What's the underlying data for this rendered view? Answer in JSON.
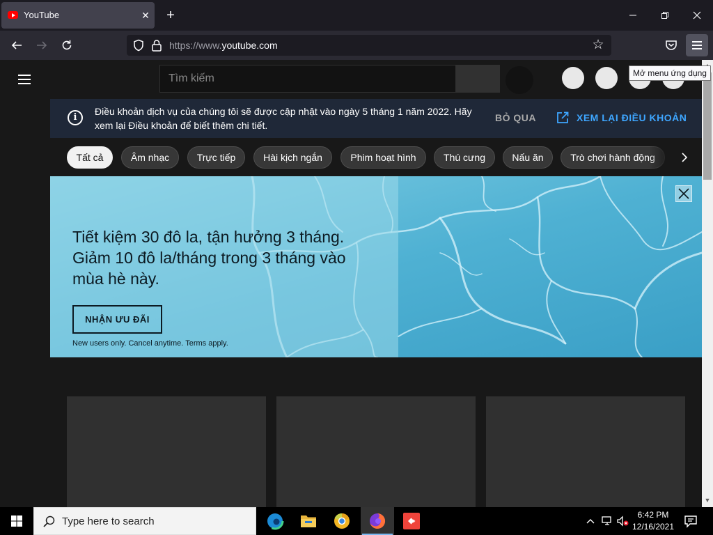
{
  "browser": {
    "tab_title": "YouTube",
    "new_tab_label": "+",
    "url_prefix": "https://www.",
    "url_host": "youtube.com",
    "menu_tooltip": "Mở menu ứng dụng",
    "icons": [
      "youtube-favicon",
      "close-icon",
      "plus-icon",
      "minimize-icon",
      "restore-icon",
      "window-close-icon",
      "back-icon",
      "forward-icon",
      "reload-icon",
      "shield-icon",
      "lock-icon",
      "star-icon",
      "pocket-icon",
      "hamburger-icon"
    ]
  },
  "youtube": {
    "search_placeholder": "Tìm kiếm",
    "notice": {
      "text": "Điều khoản dịch vụ của chúng tôi sẽ được cập nhật vào ngày 5 tháng 1 năm 2022. Hãy xem lại Điều khoản để biết thêm chi tiết.",
      "skip_label": "BỎ QUA",
      "review_label": "XEM LẠI ĐIỀU KHOẢN"
    },
    "chips": [
      "Tất cả",
      "Âm nhạc",
      "Trực tiếp",
      "Hài kịch ngắn",
      "Phim hoạt hình",
      "Thú cưng",
      "Nấu ăn",
      "Trò chơi hành động"
    ],
    "active_chip": "Tất cả",
    "banner": {
      "headline": "Tiết kiệm 30 đô la, tận hưởng 3 tháng. Giảm 10 đô la/tháng trong 3 tháng vào mùa hè này.",
      "cta_label": "NHẬN ƯU ĐÃI",
      "fine_print": "New users only. Cancel anytime. Terms apply."
    }
  },
  "taskbar": {
    "search_placeholder": "Type here to search",
    "time": "6:42 PM",
    "date": "12/16/2021",
    "apps": [
      "edge-icon",
      "file-explorer-icon",
      "chrome-canary-icon",
      "firefox-icon",
      "anydesk-icon"
    ]
  },
  "colors": {
    "tab_bg": "#42414d",
    "nav_bg": "#2b2a33",
    "page_bg": "#181818",
    "notice_bg": "#1f2838",
    "link_blue": "#3ea6ff",
    "banner_water": "#5ab7d6"
  }
}
